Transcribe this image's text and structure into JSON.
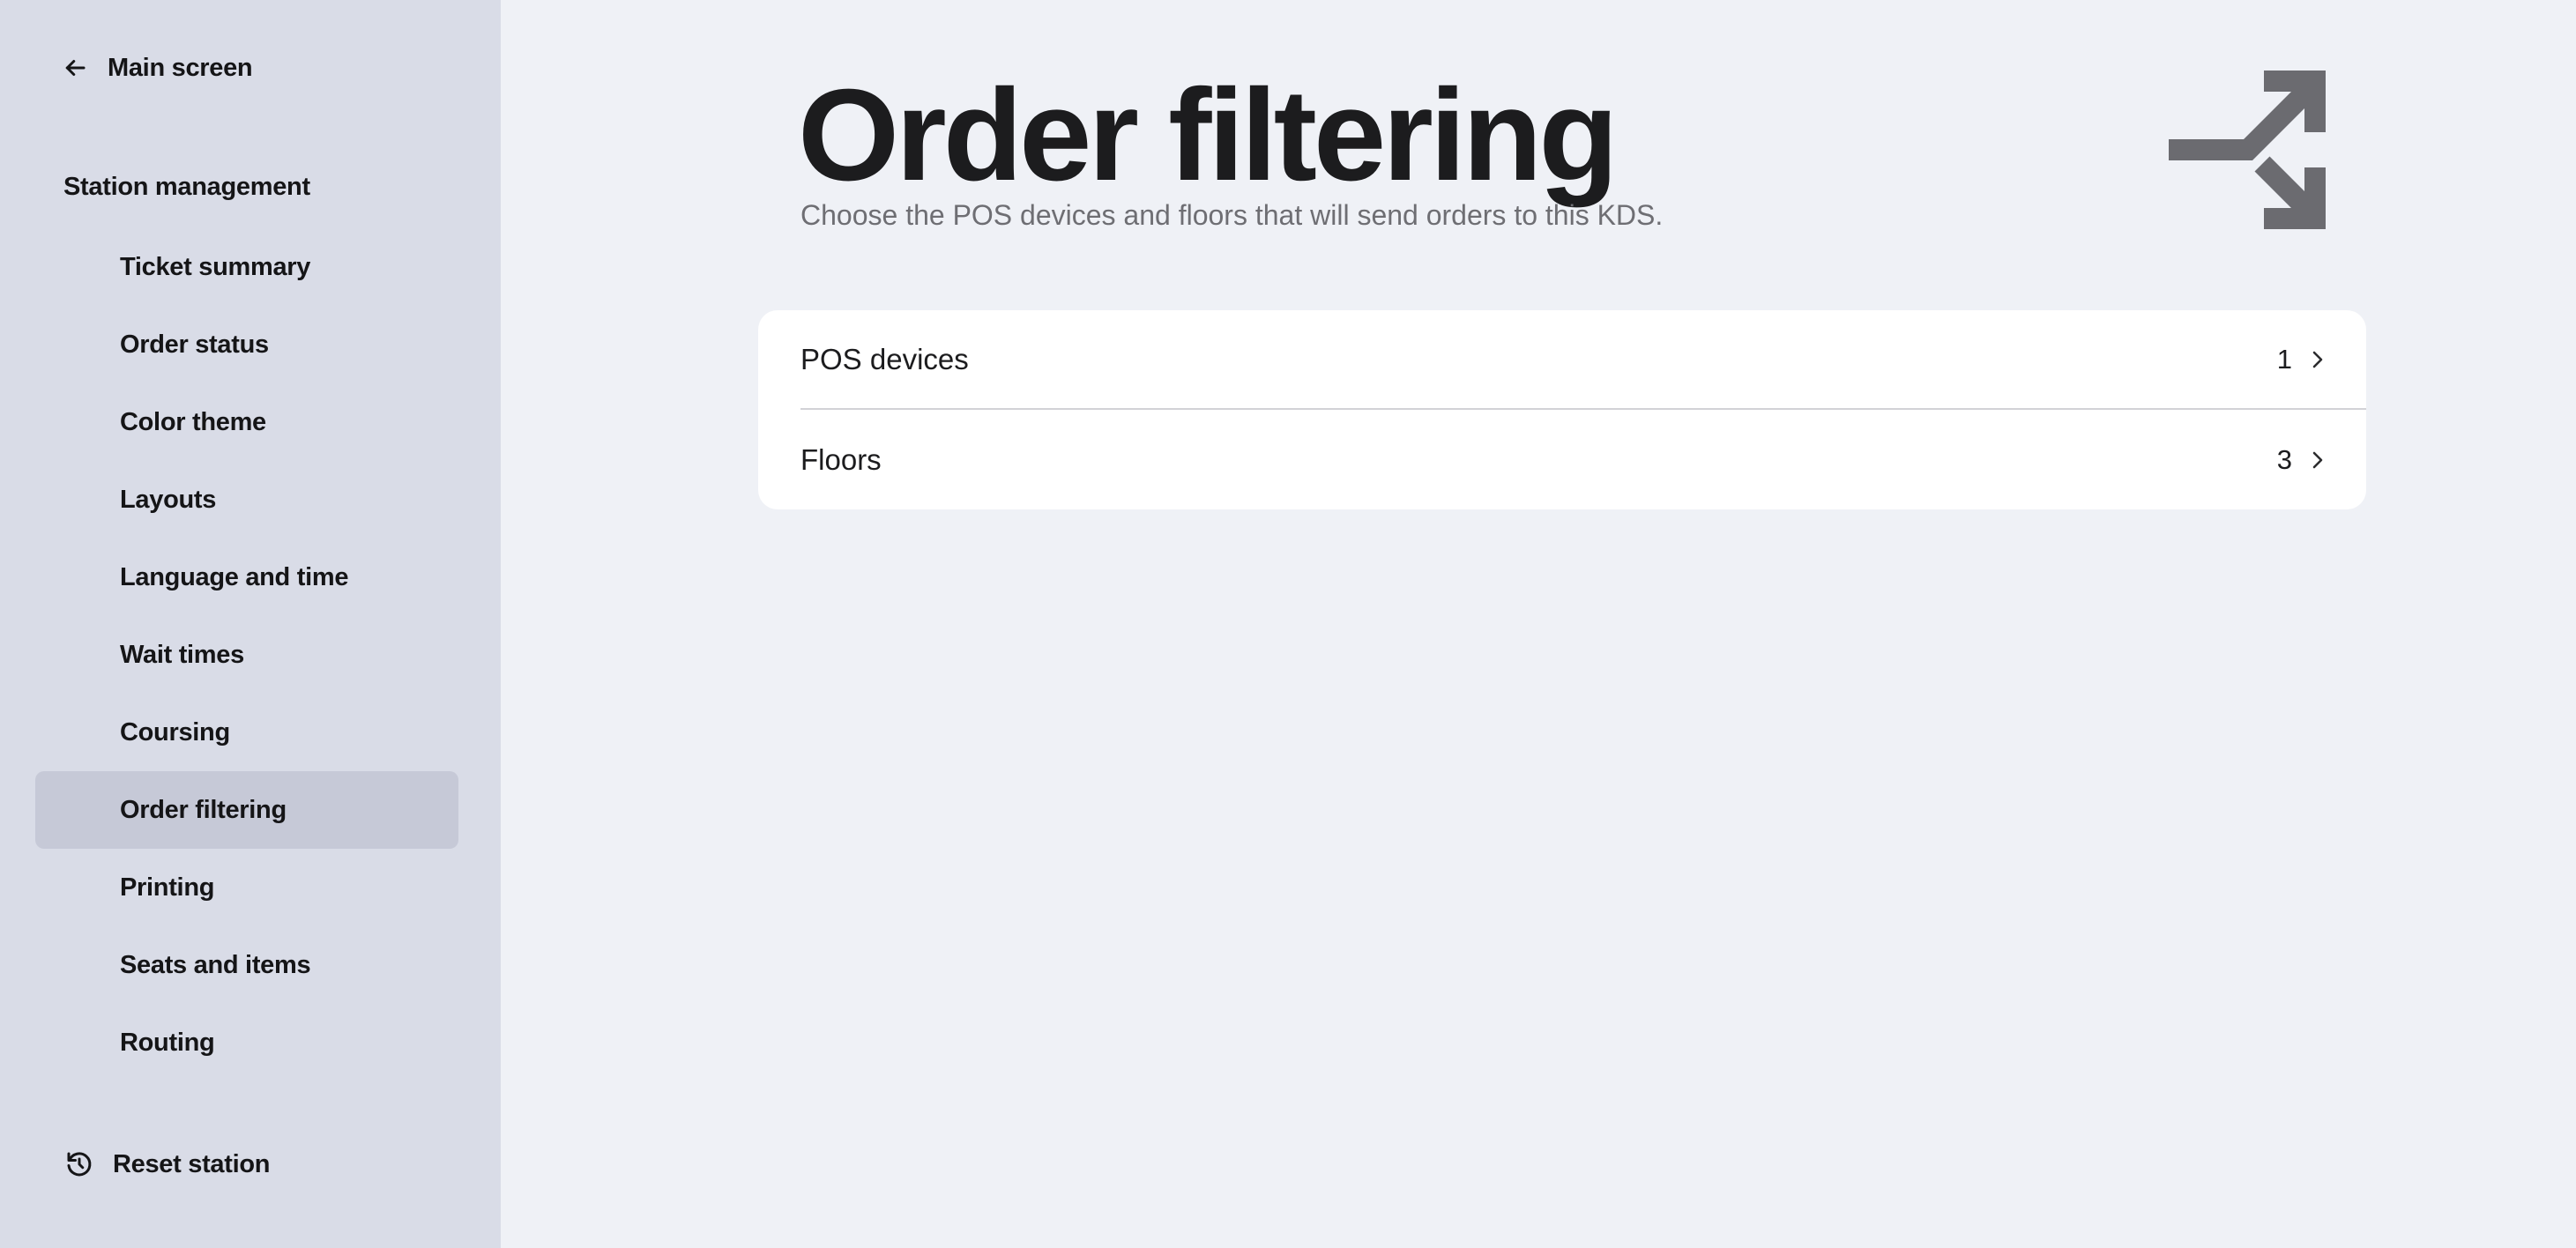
{
  "sidebar": {
    "back_label": "Main screen",
    "section_title": "Station management",
    "items": [
      {
        "label": "Ticket summary",
        "active": false
      },
      {
        "label": "Order status",
        "active": false
      },
      {
        "label": "Color theme",
        "active": false
      },
      {
        "label": "Layouts",
        "active": false
      },
      {
        "label": "Language and time",
        "active": false
      },
      {
        "label": "Wait times",
        "active": false
      },
      {
        "label": "Coursing",
        "active": false
      },
      {
        "label": "Order filtering",
        "active": true
      },
      {
        "label": "Printing",
        "active": false
      },
      {
        "label": "Seats and items",
        "active": false
      },
      {
        "label": "Routing",
        "active": false
      }
    ],
    "reset_label": "Reset station"
  },
  "main": {
    "title": "Order filtering",
    "subtitle": "Choose the POS devices and floors that will send orders to this KDS.",
    "hero_icon": "split-arrows-icon",
    "rows": [
      {
        "label": "POS devices",
        "count": "1"
      },
      {
        "label": "Floors",
        "count": "3"
      }
    ]
  },
  "colors": {
    "sidebar_bg": "#d9dce7",
    "active_item_bg": "#c6c9d7",
    "main_bg": "#eff1f6",
    "card_bg": "#ffffff",
    "icon_gray": "#6b6b70"
  }
}
